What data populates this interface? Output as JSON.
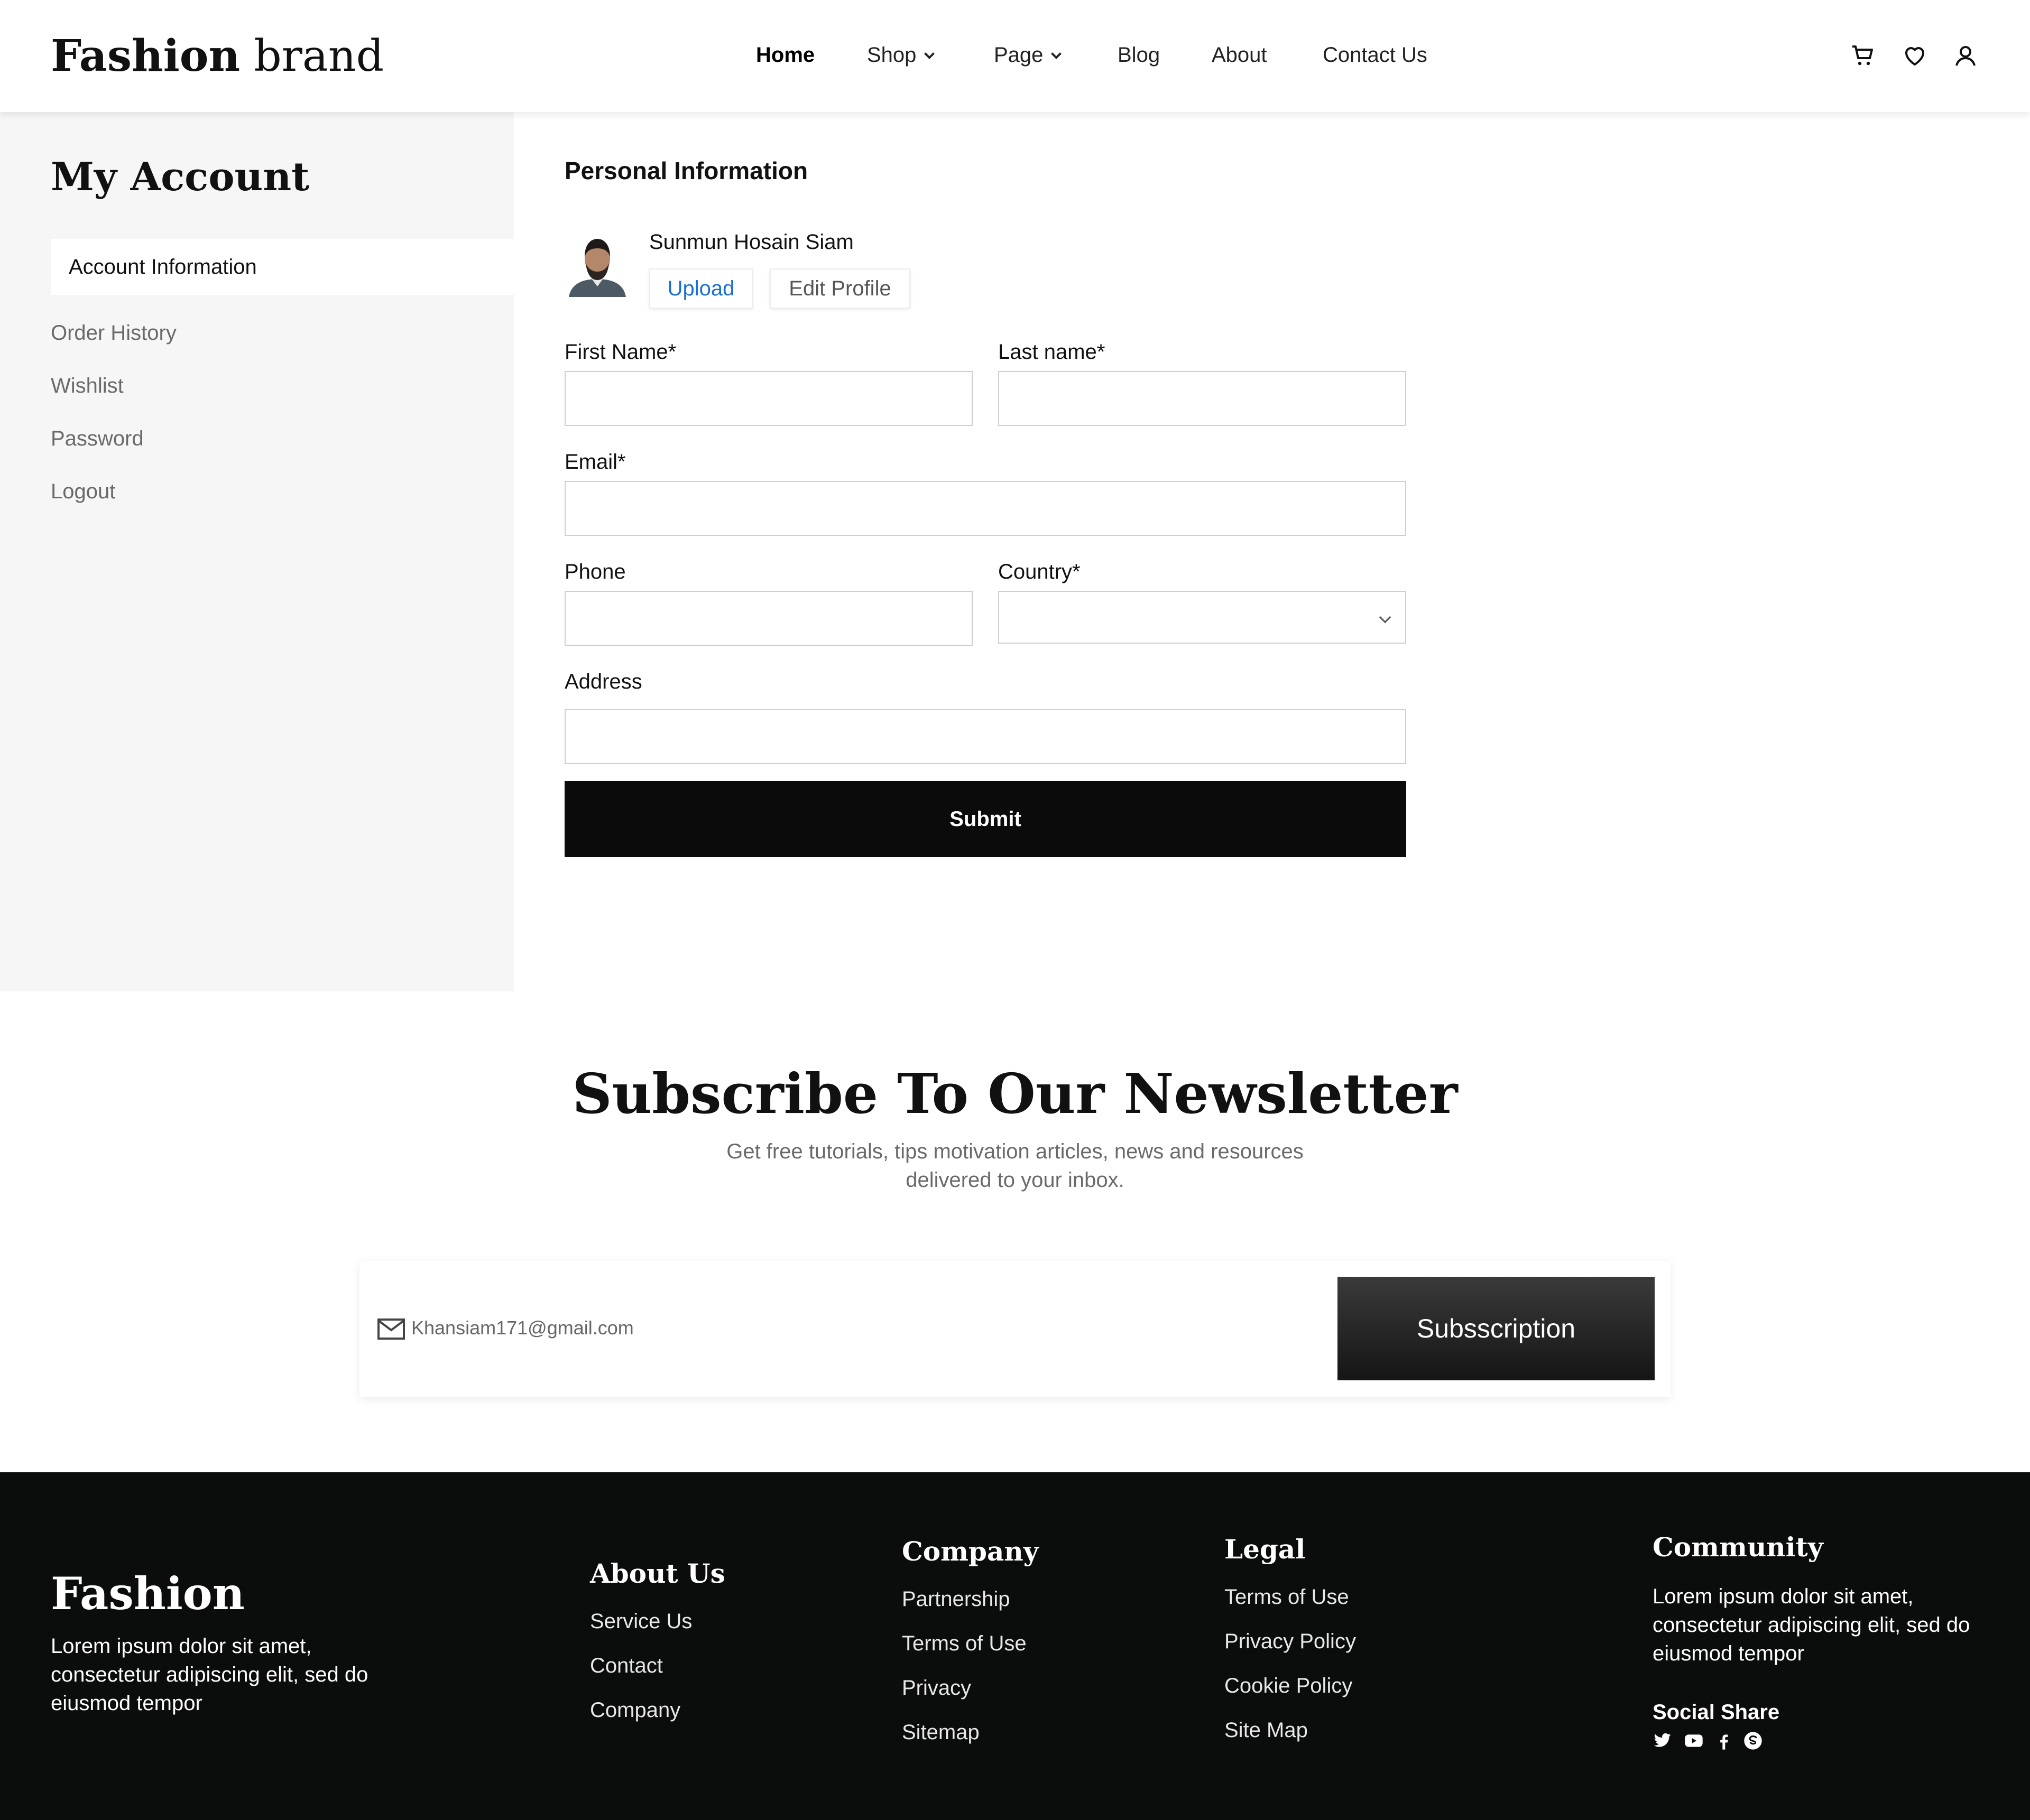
{
  "brand": {
    "strong": "Fashion",
    "light": "brand"
  },
  "nav": {
    "home": "Home",
    "shop": "Shop",
    "page": "Page",
    "blog": "Blog",
    "about": "About",
    "contact": "Contact Us"
  },
  "header_icons": [
    "cart-icon",
    "heart-icon",
    "user-icon"
  ],
  "sidebar": {
    "title": "My Account",
    "active_item": "Account Information",
    "items": [
      "Order History",
      "Wishlist",
      "Password",
      "Logout"
    ]
  },
  "profile": {
    "section_title": "Personal Information",
    "user_name": "Sunmun Hosain Siam",
    "upload_label": "Upload",
    "edit_label": "Edit Profile"
  },
  "form": {
    "first_name_label": "First Name*",
    "last_name_label": "Last name*",
    "email_label": "Email*",
    "phone_label": "Phone",
    "country_label": "Country*",
    "address_label": "Address",
    "first_name_value": "",
    "last_name_value": "",
    "email_value": "",
    "phone_value": "",
    "country_value": "",
    "address_value": "",
    "submit_label": "Submit"
  },
  "newsletter": {
    "title": "Subscribe To Our Newsletter",
    "subtitle_line1": "Get free tutorials, tips motivation articles, news and resources",
    "subtitle_line2": "delivered to your inbox.",
    "email_value": "Khansiam171@gmail.com",
    "button_label": "Subsscription"
  },
  "footer": {
    "logo": "Fashion",
    "about_line1": "Lorem ipsum dolor sit amet,",
    "about_line2": "consectetur adipiscing elit, sed do",
    "about_line3": "eiusmod tempor",
    "about_us": {
      "title": "About Us",
      "links": [
        "Service Us",
        "Contact",
        "Company"
      ]
    },
    "company": {
      "title": "Company",
      "links": [
        "Partnership",
        "Terms of Use",
        "Privacy",
        "Sitemap"
      ]
    },
    "legal": {
      "title": "Legal",
      "links": [
        "Terms of Use",
        "Privacy Policy",
        "Cookie Policy",
        "Site Map"
      ]
    },
    "community": {
      "title": "Community",
      "line1": "Lorem ipsum dolor sit amet,",
      "line2": "consectetur adipiscing elit, sed do",
      "line3": "eiusmod tempor",
      "share_label": "Social Share",
      "social_icons": [
        "twitter-icon",
        "youtube-icon",
        "facebook-icon",
        "skype-icon"
      ]
    }
  },
  "colors": {
    "accent_link": "#1a6fd6",
    "dark": "#0b0b0b",
    "sidebar_bg": "#f6f6f6"
  }
}
